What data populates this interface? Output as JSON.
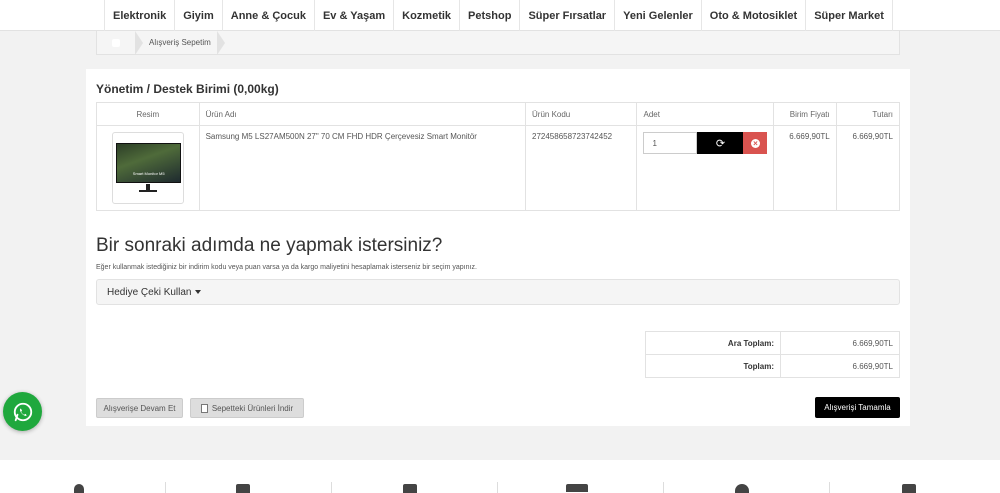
{
  "nav": {
    "items": [
      "Elektronik",
      "Giyim",
      "Anne & Çocuk",
      "Ev & Yaşam",
      "Kozmetik",
      "Petshop",
      "Süper Fırsatlar",
      "Yeni Gelenler",
      "Oto & Motosiklet",
      "Süper Market"
    ]
  },
  "breadcrumb": {
    "current": "Alışveriş Sepetim"
  },
  "section": {
    "title": "Yönetim / Destek Birimi  (0,00kg)"
  },
  "table": {
    "headers": [
      "Resim",
      "Ürün Adı",
      "Ürün Kodu",
      "Adet",
      "Birim Fiyatı",
      "Tutarı"
    ],
    "row": {
      "thumb_text": "Smart Monitor M5",
      "name": "Samsung M5 LS27AM500N 27\" 70 CM FHD HDR Çerçevesiz Smart Monitör",
      "code": "272458658723742452",
      "qty": "1",
      "unit_price": "6.669,90TL",
      "total": "6.669,90TL"
    }
  },
  "next": {
    "title": "Bir sonraki adımda ne yapmak istersiniz?",
    "desc": "Eğer kullanmak istediğiniz bir indirim kodu veya puan varsa ya da kargo maliyetini hesaplamak isterseniz bir seçim yapınız.",
    "gift_label": "Hediye Çeki Kullan"
  },
  "totals": {
    "subtotal_label": "Ara Toplam:",
    "subtotal_value": "6.669,90TL",
    "total_label": "Toplam:",
    "total_value": "6.669,90TL"
  },
  "buttons": {
    "continue": "Alışverişe Devam Et",
    "download": "Sepetteki Ürünleri İndir",
    "complete": "Alışverişi Tamamla"
  },
  "icons": {
    "refresh": "refresh-icon",
    "remove": "remove-icon",
    "whatsapp": "whatsapp-icon",
    "home": "home-icon",
    "document": "document-icon"
  },
  "colors": {
    "danger": "#d9534f",
    "whatsapp": "#1fa83d",
    "primary": "#000000"
  }
}
